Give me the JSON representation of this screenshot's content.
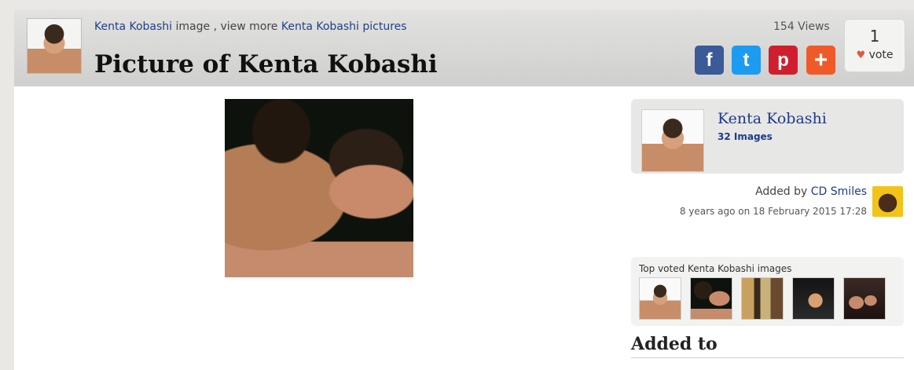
{
  "header": {
    "crumb_person": "Kenta Kobashi",
    "crumb_mid": " image , view more ",
    "crumb_link": "Kenta Kobashi pictures",
    "title": "Picture of Kenta Kobashi",
    "views": "154 Views",
    "vote_count": "1",
    "vote_label": "vote"
  },
  "share": {
    "facebook": "f",
    "twitter": "t",
    "pinterest": "p",
    "more": "+"
  },
  "sidebar": {
    "name": "Kenta Kobashi",
    "count": "32 Images",
    "added_by_prefix": "Added by ",
    "added_by_user": "CD Smiles",
    "added_date": "8 years ago on 18 February 2015 17:28",
    "top_voted_label": "Top voted Kenta Kobashi images",
    "added_to": "Added to"
  },
  "colors": {
    "link": "#213f8b",
    "facebook": "#3b5a98",
    "twitter": "#1d9bf0",
    "pinterest": "#cf1f2e",
    "more": "#f05a28"
  }
}
